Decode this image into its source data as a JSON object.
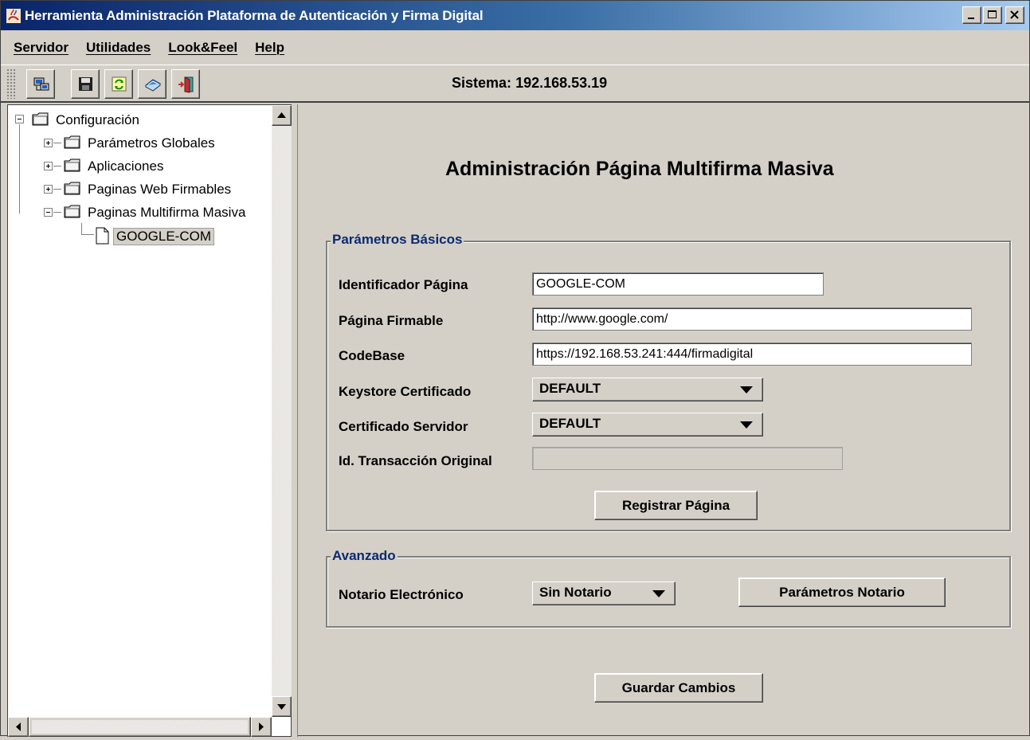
{
  "window": {
    "title": "Herramienta Administración Plataforma de Autenticación y Firma Digital"
  },
  "menu": [
    "Servidor",
    "Utilidades",
    "Look&Feel",
    "Help"
  ],
  "toolbar": {
    "buttons": [
      "network-computer-icon",
      "save-disk-icon",
      "refresh-icon",
      "book-icon",
      "exit-door-icon"
    ],
    "sistema_label": "Sistema:",
    "sistema_value": "192.168.53.19"
  },
  "tree": {
    "root": "Configuración",
    "children": [
      "Parámetros Globales",
      "Aplicaciones",
      "Paginas Web Firmables",
      "Paginas Multifirma Masiva"
    ],
    "leaf": "GOOGLE-COM"
  },
  "main": {
    "title": "Administración Página Multifirma Masiva",
    "basic": {
      "title": "Parámetros Básicos",
      "id_label": "Identificador Página",
      "id_value": "GOOGLE-COM",
      "page_label": "Página Firmable",
      "page_value": "http://www.google.com/",
      "codebase_label": "CodeBase",
      "codebase_value": "https://192.168.53.241:444/firmadigital",
      "keystore_label": "Keystore Certificado",
      "keystore_value": "DEFAULT",
      "cert_label": "Certificado Servidor",
      "cert_value": "DEFAULT",
      "txid_label": "Id. Transacción Original",
      "txid_value": "",
      "register_button": "Registrar Página"
    },
    "advanced": {
      "title": "Avanzado",
      "notary_label": "Notario Electrónico",
      "notary_value": "Sin Notario",
      "notary_params_button": "Parámetros Notario"
    },
    "save_button": "Guardar Cambios"
  }
}
